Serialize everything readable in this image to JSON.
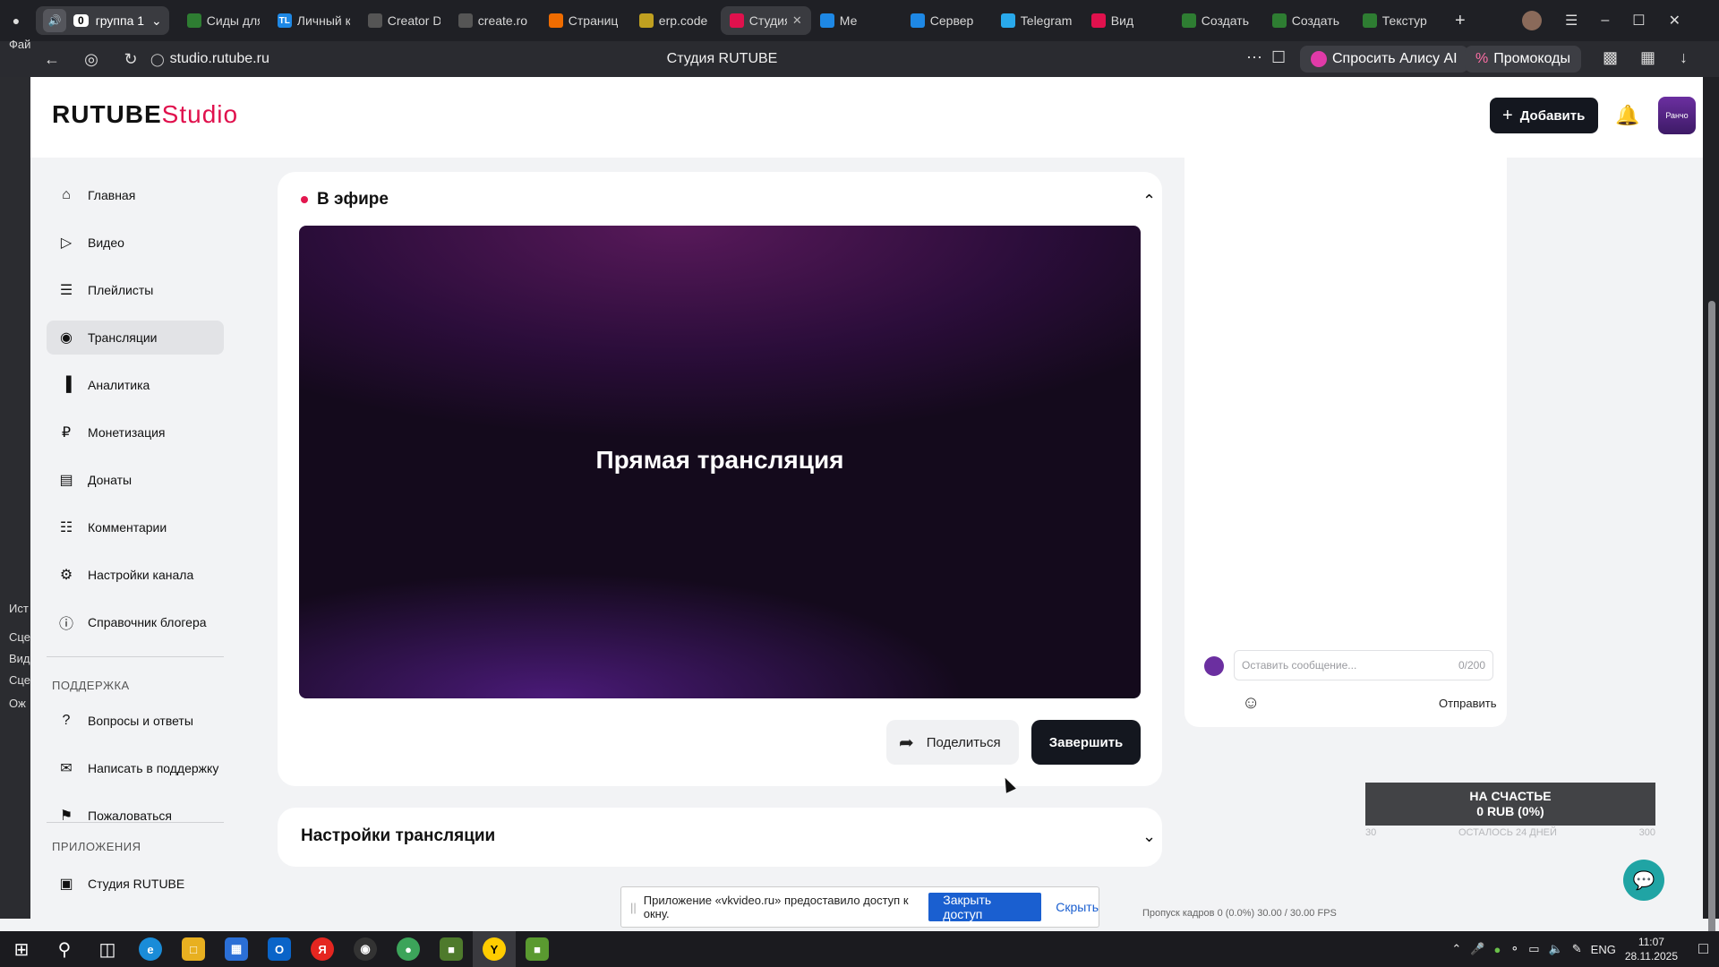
{
  "browser": {
    "group_count": "0",
    "group_name": "группа 1",
    "tabs": [
      {
        "title": "Сиды для",
        "color": "#2e7d32"
      },
      {
        "title": "Личный к",
        "color": "#1e88e5",
        "glyph": "TL"
      },
      {
        "title": "Creator D",
        "color": "#555555"
      },
      {
        "title": "create.ro",
        "color": "#555555"
      },
      {
        "title": "Страниц",
        "color": "#ef6c00"
      },
      {
        "title": "erp.code",
        "color": "#c0a020"
      },
      {
        "title": "Студия",
        "color": "#e0114d",
        "active": true
      },
      {
        "title": "Ме",
        "color": "#1e88e5"
      },
      {
        "title": "Сервер",
        "color": "#1e88e5"
      },
      {
        "title": "Telegram",
        "color": "#29a9eb"
      },
      {
        "title": "Вид",
        "color": "#e0114d"
      },
      {
        "title": "Создать",
        "color": "#2e7d32"
      },
      {
        "title": "Создать",
        "color": "#2e7d32"
      },
      {
        "title": "Текстур",
        "color": "#2e7d32"
      }
    ],
    "url": "studio.rutube.ru",
    "page_title": "Студия RUTUBE",
    "alice_label": "Спросить Алису AI",
    "promo_label": "Промокоды"
  },
  "left_strip": [
    "Фай",
    "Ист",
    "Сце",
    "Вид",
    "Сце",
    "Ож"
  ],
  "app": {
    "logo": "RUTUBE",
    "logo_suffix": "Studio",
    "add_button": "Добавить",
    "avatar_text": "Ранчо"
  },
  "sidebar": {
    "items": [
      {
        "label": "Главная",
        "icon": "home-icon"
      },
      {
        "label": "Видео",
        "icon": "video-icon"
      },
      {
        "label": "Плейлисты",
        "icon": "playlist-icon"
      },
      {
        "label": "Трансляции",
        "icon": "broadcast-icon",
        "active": true
      },
      {
        "label": "Аналитика",
        "icon": "analytics-icon"
      },
      {
        "label": "Монетизация",
        "icon": "ruble-icon"
      },
      {
        "label": "Донаты",
        "icon": "donate-icon"
      },
      {
        "label": "Комментарии",
        "icon": "comment-icon"
      },
      {
        "label": "Настройки канала",
        "icon": "gear-icon"
      },
      {
        "label": "Справочник блогера",
        "icon": "info-icon"
      }
    ],
    "support_heading": "ПОДДЕРЖКА",
    "support_items": [
      {
        "label": "Вопросы и ответы",
        "icon": "question-icon"
      },
      {
        "label": "Написать в поддержку",
        "icon": "mail-icon"
      },
      {
        "label": "Пожаловаться",
        "icon": "flag-icon"
      }
    ],
    "apps_heading": "ПРИЛОЖЕНИЯ",
    "apps_items": [
      {
        "label": "Студия RUTUBE",
        "icon": "studio-icon"
      }
    ]
  },
  "live": {
    "title": "В эфире",
    "player_text": "Прямая трансляция",
    "share_label": "Поделиться",
    "end_label": "Завершить"
  },
  "settings": {
    "title": "Настройки трансляции"
  },
  "chat": {
    "placeholder": "Оставить сообщение...",
    "counter": "0/200",
    "send_label": "Отправить"
  },
  "goal": {
    "line1": "НА СЧАСТЬЕ",
    "line2": "0 RUB (0%)",
    "left": "30",
    "center": "ОСТАЛОСЬ 24 ДНЕЙ",
    "right": "300"
  },
  "obs_status": "Пропуск кадров 0 (0.0%)    30.00 / 30.00 FPS",
  "notice": {
    "text": "Приложение «vkvideo.ru» предоставило доступ к окну.",
    "revoke": "Закрыть доступ",
    "hide": "Скрыть"
  },
  "taskbar": {
    "lang": "ENG",
    "time": "11:07",
    "date": "28.11.2025"
  },
  "colors": {
    "brand": "#e0114d",
    "dark_button": "#14171f",
    "notice_button": "#1a5fd0",
    "help": "#20a4a4"
  }
}
